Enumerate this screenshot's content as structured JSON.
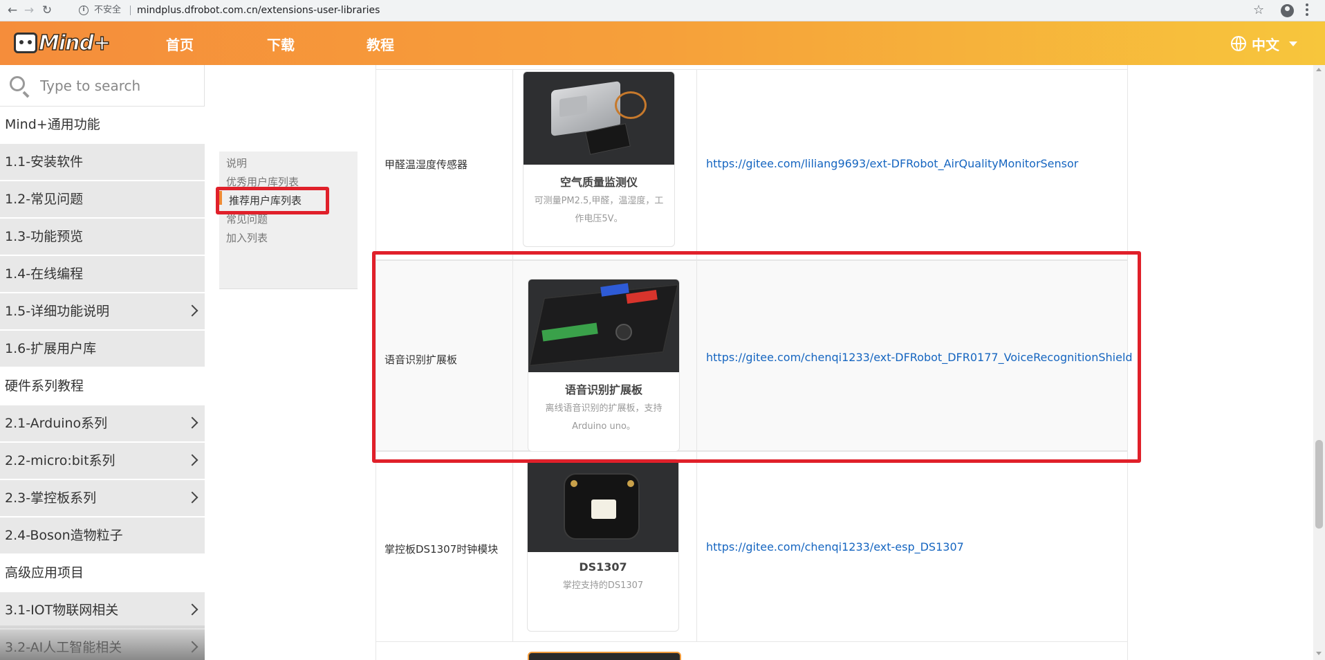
{
  "browser": {
    "insecure_label": "不安全",
    "url": "mindplus.dfrobot.com.cn/extensions-user-libraries"
  },
  "header": {
    "logo_text": "Mind+",
    "nav": [
      "首页",
      "下载",
      "教程"
    ],
    "lang": "中文",
    "accent": "#f58d3b"
  },
  "sidebar": {
    "search_placeholder": "Type to search",
    "items": [
      {
        "label": "Mind+通用功能",
        "type": "group",
        "chevron": false
      },
      {
        "label": "1.1-安装软件",
        "type": "sub",
        "chevron": false
      },
      {
        "label": "1.2-常见问题",
        "type": "sub",
        "chevron": false
      },
      {
        "label": "1.3-功能预览",
        "type": "sub",
        "chevron": false
      },
      {
        "label": "1.4-在线编程",
        "type": "sub",
        "chevron": false
      },
      {
        "label": "1.5-详细功能说明",
        "type": "sub",
        "chevron": true
      },
      {
        "label": "1.6-扩展用户库",
        "type": "sub",
        "chevron": false
      },
      {
        "label": "硬件系列教程",
        "type": "group",
        "chevron": false
      },
      {
        "label": "2.1-Arduino系列",
        "type": "sub",
        "chevron": true
      },
      {
        "label": "2.2-micro:bit系列",
        "type": "sub",
        "chevron": true
      },
      {
        "label": "2.3-掌控板系列",
        "type": "sub",
        "chevron": true
      },
      {
        "label": "2.4-Boson造物粒子",
        "type": "sub",
        "chevron": false
      },
      {
        "label": "高级应用项目",
        "type": "group",
        "chevron": false
      },
      {
        "label": "3.1-IOT物联网相关",
        "type": "sub",
        "chevron": true
      },
      {
        "label": "3.2-AI人工智能相关",
        "type": "sub",
        "chevron": true
      }
    ]
  },
  "toc": {
    "items": [
      "说明",
      "优秀用户库列表",
      "推荐用户库列表",
      "常见问题",
      "加入列表"
    ],
    "active_index": 2
  },
  "table": {
    "rows": [
      {
        "name": "甲醛温湿度传感器",
        "card_title": "空气质量监测仪",
        "card_desc": "可测量PM2.5,甲醛，温湿度，工作电压5V。",
        "link": "https://gitee.com/liliang9693/ext-DFRobot_AirQualityMonitorSensor"
      },
      {
        "name": "语音识别扩展板",
        "card_title": "语音识别扩展板",
        "card_desc": "离线语音识别的扩展板，支持Arduino uno。",
        "link": "https://gitee.com/chenqi1233/ext-DFRobot_DFR0177_VoiceRecognitionShield"
      },
      {
        "name": "掌控板DS1307时钟模块",
        "card_title": "DS1307",
        "card_desc": "掌控支持的DS1307",
        "link": "https://gitee.com/chenqi1233/ext-esp_DS1307"
      }
    ]
  },
  "colors": {
    "highlight_red": "#e0202a",
    "link_blue": "#1565c0"
  }
}
